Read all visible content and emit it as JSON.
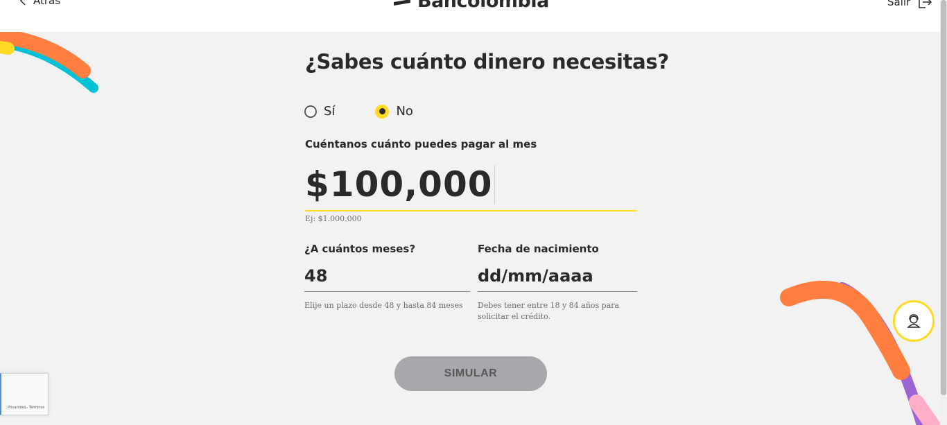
{
  "header": {
    "back_label": "Atrás",
    "brand": "Bancolombia",
    "exit_label": "Salir"
  },
  "icons": {
    "back": "chevron-left-icon",
    "logo": "bancolombia-logo-icon",
    "exit": "exit-icon",
    "help": "support-agent-icon"
  },
  "colors": {
    "accent": "#fdda24",
    "background": "#f2f2f2",
    "button_disabled": "#a6a8ab",
    "deco_orange": "#ff7f41",
    "deco_cyan": "#00c1d5",
    "deco_purple": "#9c65d1",
    "deco_pink": "#ffb0c8"
  },
  "form": {
    "title": "¿Sabes cuánto dinero necesitas?",
    "radio_options": [
      {
        "label": "Sí",
        "selected": false
      },
      {
        "label": "No",
        "selected": true
      }
    ],
    "payment_label": "Cuéntanos cuánto puedes pagar al mes",
    "payment_value": "$100,000",
    "payment_hint": "Ej: $1.000.000",
    "months_label": "¿A cuántos meses?",
    "months_value": "48",
    "months_hint": "Elije un plazo desde 48 y hasta 84 meses",
    "birth_label": "Fecha de nacimiento",
    "birth_placeholder": "dd/mm/aaaa",
    "birth_hint_line1": "Debes tener entre 18 y 84 años para",
    "birth_hint_line2": "solicitar el crédito.",
    "submit_label": "SIMULAR"
  },
  "recaptcha": {
    "text": "Privacidad - Términos"
  }
}
